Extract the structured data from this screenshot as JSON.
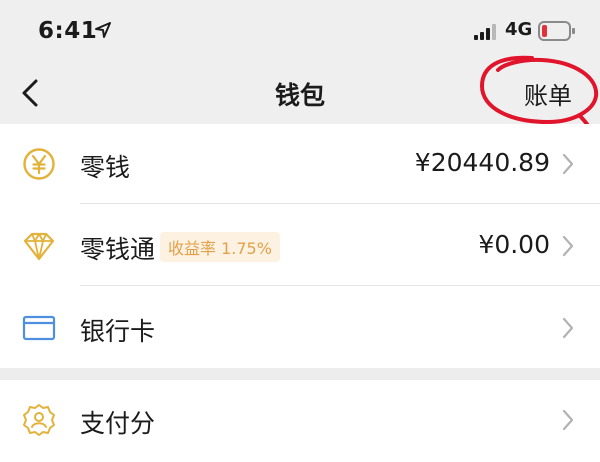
{
  "status_bar": {
    "time": "6:41",
    "network": "4G",
    "icons": [
      "location-arrow-icon",
      "signal-bars-icon",
      "battery-low-icon"
    ]
  },
  "nav": {
    "title": "钱包",
    "action_label": "账单",
    "back_icon": "chevron-left-icon"
  },
  "wallet_items": [
    {
      "label": "零钱",
      "value": "¥20440.89",
      "icon": "yen-coin-icon"
    },
    {
      "label": "零钱通",
      "badge": "收益率 1.75%",
      "value": "¥0.00",
      "icon": "diamond-icon"
    },
    {
      "label": "银行卡",
      "value": "",
      "icon": "bank-card-icon"
    }
  ],
  "services": [
    {
      "label": "支付分",
      "icon": "score-badge-icon"
    }
  ],
  "colors": {
    "gold": "#e2b23a",
    "card_blue": "#4f8fe0",
    "annotation_red": "#e0142b",
    "badge_bg": "#fdf1e1",
    "badge_text": "#e2a14a",
    "battery_red": "#e3313a"
  }
}
